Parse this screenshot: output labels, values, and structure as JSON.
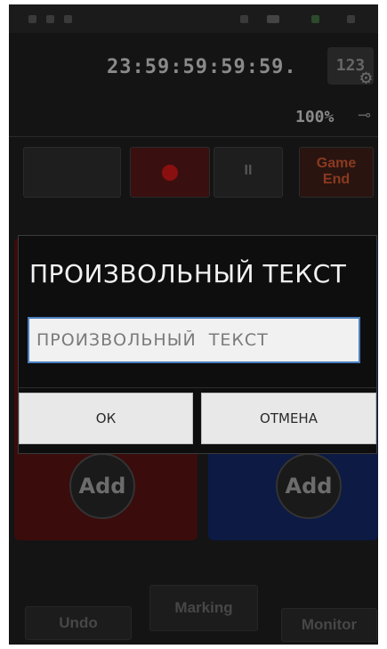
{
  "app": {
    "time_display": "23:59:59:59:59.",
    "settings_label": "123",
    "battery_text": "100%"
  },
  "controls": {
    "pause_label": "II",
    "game_end_label_1": "Game",
    "game_end_label_2": "End"
  },
  "teams": {
    "red": {
      "add_label": "Add",
      "color": "#3a0c0c"
    },
    "blue": {
      "add_label": "Add",
      "color": "#0c1a44"
    }
  },
  "bottom": {
    "undo_label": "Undo",
    "marking_label": "Marking",
    "monitor_label": "Monitor"
  },
  "dialog": {
    "title": "ПРОИЗВОЛЬНЫЙ ТЕКСТ",
    "input_value": "ПРОИЗВОЛЬНЫЙ  ТЕКСТ",
    "ok_label": "ОК",
    "cancel_label": "ОТМЕНА",
    "accent_color": "#4a7fc0"
  },
  "icons": [
    "gear-icon",
    "plug-icon",
    "record-icon",
    "pause-icon"
  ]
}
